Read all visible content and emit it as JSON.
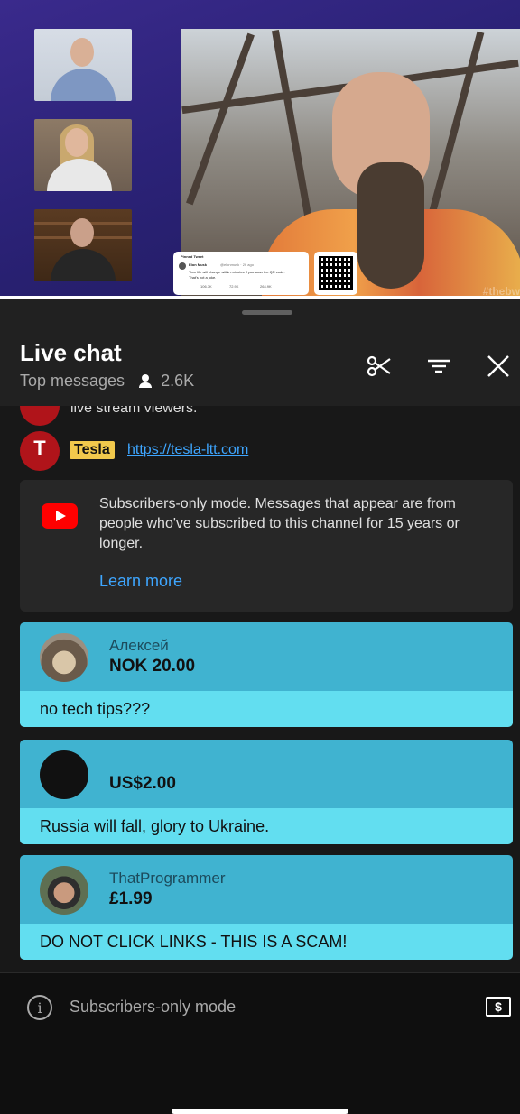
{
  "stream": {
    "pinned_tweet": {
      "header": "Pinned Tweet",
      "author": "Elon Musk",
      "handle": "@elonmusk · 2h ago",
      "text_line1": "Your life will change within minutes if you scan the QR code.",
      "text_line2": "That's not a joke.",
      "replies": "106.7K",
      "retweets": "72.9K",
      "likes": "264.9K"
    },
    "hashtag": "#thebw",
    "progress_fraction": 1.0
  },
  "chat": {
    "title": "Live chat",
    "mode_label": "Top messages",
    "viewer_count": "2.6K",
    "clipped_message": "live stream viewers.",
    "tesla_message": {
      "badge": "Tesla",
      "logo_text": "TESLA",
      "link": "https://tesla-ltt.com"
    },
    "notice": {
      "text": "Subscribers-only mode. Messages that appear are from people who've subscribed to this channel for 15 years or longer.",
      "link": "Learn more"
    },
    "super_chats": [
      {
        "name": "Алексей",
        "amount": "NOK 20.00",
        "message": "no tech tips???"
      },
      {
        "name": "",
        "amount": "US$2.00",
        "message": "Russia will fall, glory to Ukraine."
      },
      {
        "name": "ThatProgrammer",
        "amount": "£1.99",
        "message": "DO NOT CLICK LINKS - THIS IS A SCAM!"
      }
    ],
    "footer": {
      "mode_text": "Subscribers-only mode",
      "info_glyph": "i",
      "dollar_glyph": "$"
    }
  },
  "icons": {
    "scissors": "scissors-icon",
    "filter": "filter-icon",
    "close": "close-icon"
  },
  "colors": {
    "superchat_header": "#40b3d0",
    "superchat_body": "#62def0",
    "tesla_badge": "#f2c94c",
    "link": "#3ea6ff",
    "youtube_red": "#ff0000"
  }
}
